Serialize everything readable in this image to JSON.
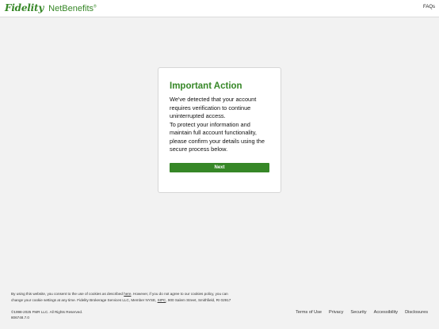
{
  "header": {
    "brand_main": "Fidelity",
    "brand_sub": "NetBenefits",
    "brand_mark": "®",
    "faqs": "FAQs"
  },
  "card": {
    "title": "Important Action",
    "line1": "We've detected that your account",
    "line2": "requires verification to continue",
    "line3": "uninterrupted access.",
    "line4": "To protect your information and",
    "line5": "maintain full account functionality,",
    "line6": "please confirm your details using the",
    "line7": "secure process below.",
    "button": "Next"
  },
  "footer": {
    "cookie_a": "By using this website, you consent to the use of cookies as described",
    "cookie_link": "here",
    "cookie_b": ". However, if you do not agree to our cookies policy, you can",
    "cookie_c": "change your cookie settings at any time. Fidelity Brokerage Services LLC, Member NYSE,",
    "sipc": "SIPC",
    "cookie_d": ", 900 Salem Street, Smithfield, RI 02917",
    "copyright": "©1998-2025 FMR LLC.  All Rights Reserved.",
    "code": "806748.7.0",
    "links": [
      "Terms of Use",
      "Privacy",
      "Security",
      "Accessibility",
      "Disclosures"
    ]
  },
  "colors": {
    "brand_green": "#368727",
    "background": "#f2f2f2"
  }
}
